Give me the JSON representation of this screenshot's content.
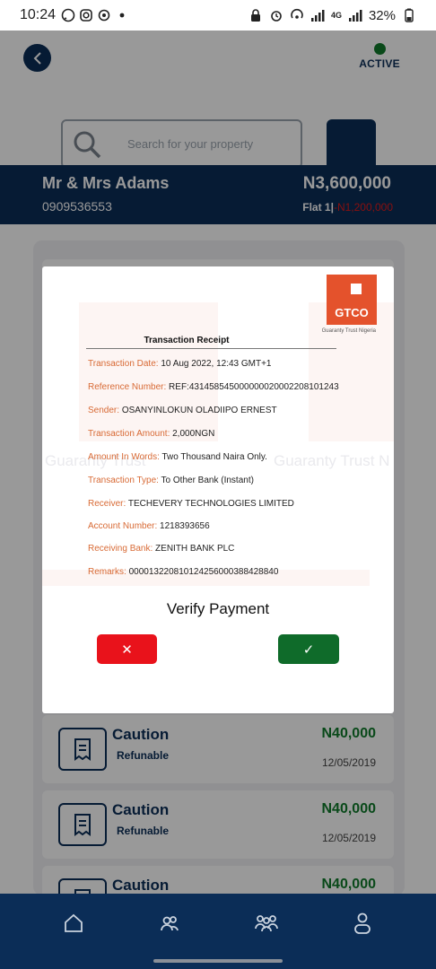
{
  "status_bar": {
    "time": "10:24",
    "battery": "32%",
    "network": "4G"
  },
  "header": {
    "status_label": "ACTIVE",
    "status_color": "#0f7a2b"
  },
  "search": {
    "placeholder": "Search for your property"
  },
  "customer": {
    "name": "Mr & Mrs Adams",
    "phone": "0909536553",
    "amount": "N3,600,000",
    "flat_label": "Flat 1|",
    "flat_amount": "-N1,200,000"
  },
  "payments": [
    {
      "title": "Caution",
      "subtitle": "Refunable",
      "amount": "N40,000",
      "date": "12/05/2019"
    },
    {
      "title": "Caution",
      "subtitle": "Refunable",
      "amount": "N40,000",
      "date": "12/05/2019"
    },
    {
      "title": "Caution",
      "subtitle": "",
      "amount": "N40,000",
      "date": ""
    }
  ],
  "receipt": {
    "bank_logo_text": "GTCO",
    "bank_tagline": "Guaranty Trust Nigeria",
    "title": "Transaction Receipt",
    "rows": [
      {
        "label": "Transaction Date:",
        "value": "10 Aug 2022, 12:43 GMT+1"
      },
      {
        "label": "Reference Number:",
        "value": "REF:431458545000000020002208101243"
      },
      {
        "label": "Sender:",
        "value": "OSANYINLOKUN OLADIIPO ERNEST"
      },
      {
        "label": "Transaction Amount:",
        "value": "2,000NGN"
      },
      {
        "label": "Amount In Words:",
        "value": "Two Thousand  Naira Only."
      },
      {
        "label": "Transaction Type:",
        "value": "To Other Bank (Instant)"
      },
      {
        "label": "Receiver:",
        "value": "TECHEVERY TECHNOLOGIES LIMITED"
      },
      {
        "label": "Account Number:",
        "value": "1218393656"
      },
      {
        "label": "Receiving Bank:",
        "value": "ZENITH BANK PLC"
      },
      {
        "label": "Remarks:",
        "value": "000013220810124256000388428840"
      }
    ],
    "watermark_left": "Guaranty Trust",
    "watermark_right": "Guaranty Trust N"
  },
  "modal": {
    "title": "Verify Payment",
    "reject_symbol": "✕",
    "accept_symbol": "✓",
    "reject_color": "#e9121b",
    "accept_color": "#0f6b2a"
  },
  "bottom_nav": {
    "items": [
      {
        "icon": "home-icon"
      },
      {
        "icon": "users-icon"
      },
      {
        "icon": "group-icon"
      },
      {
        "icon": "profile-icon"
      }
    ]
  },
  "colors": {
    "primary": "#0b2d57",
    "brand_orange": "#e4522c",
    "amount_green": "#0f7a2b"
  }
}
